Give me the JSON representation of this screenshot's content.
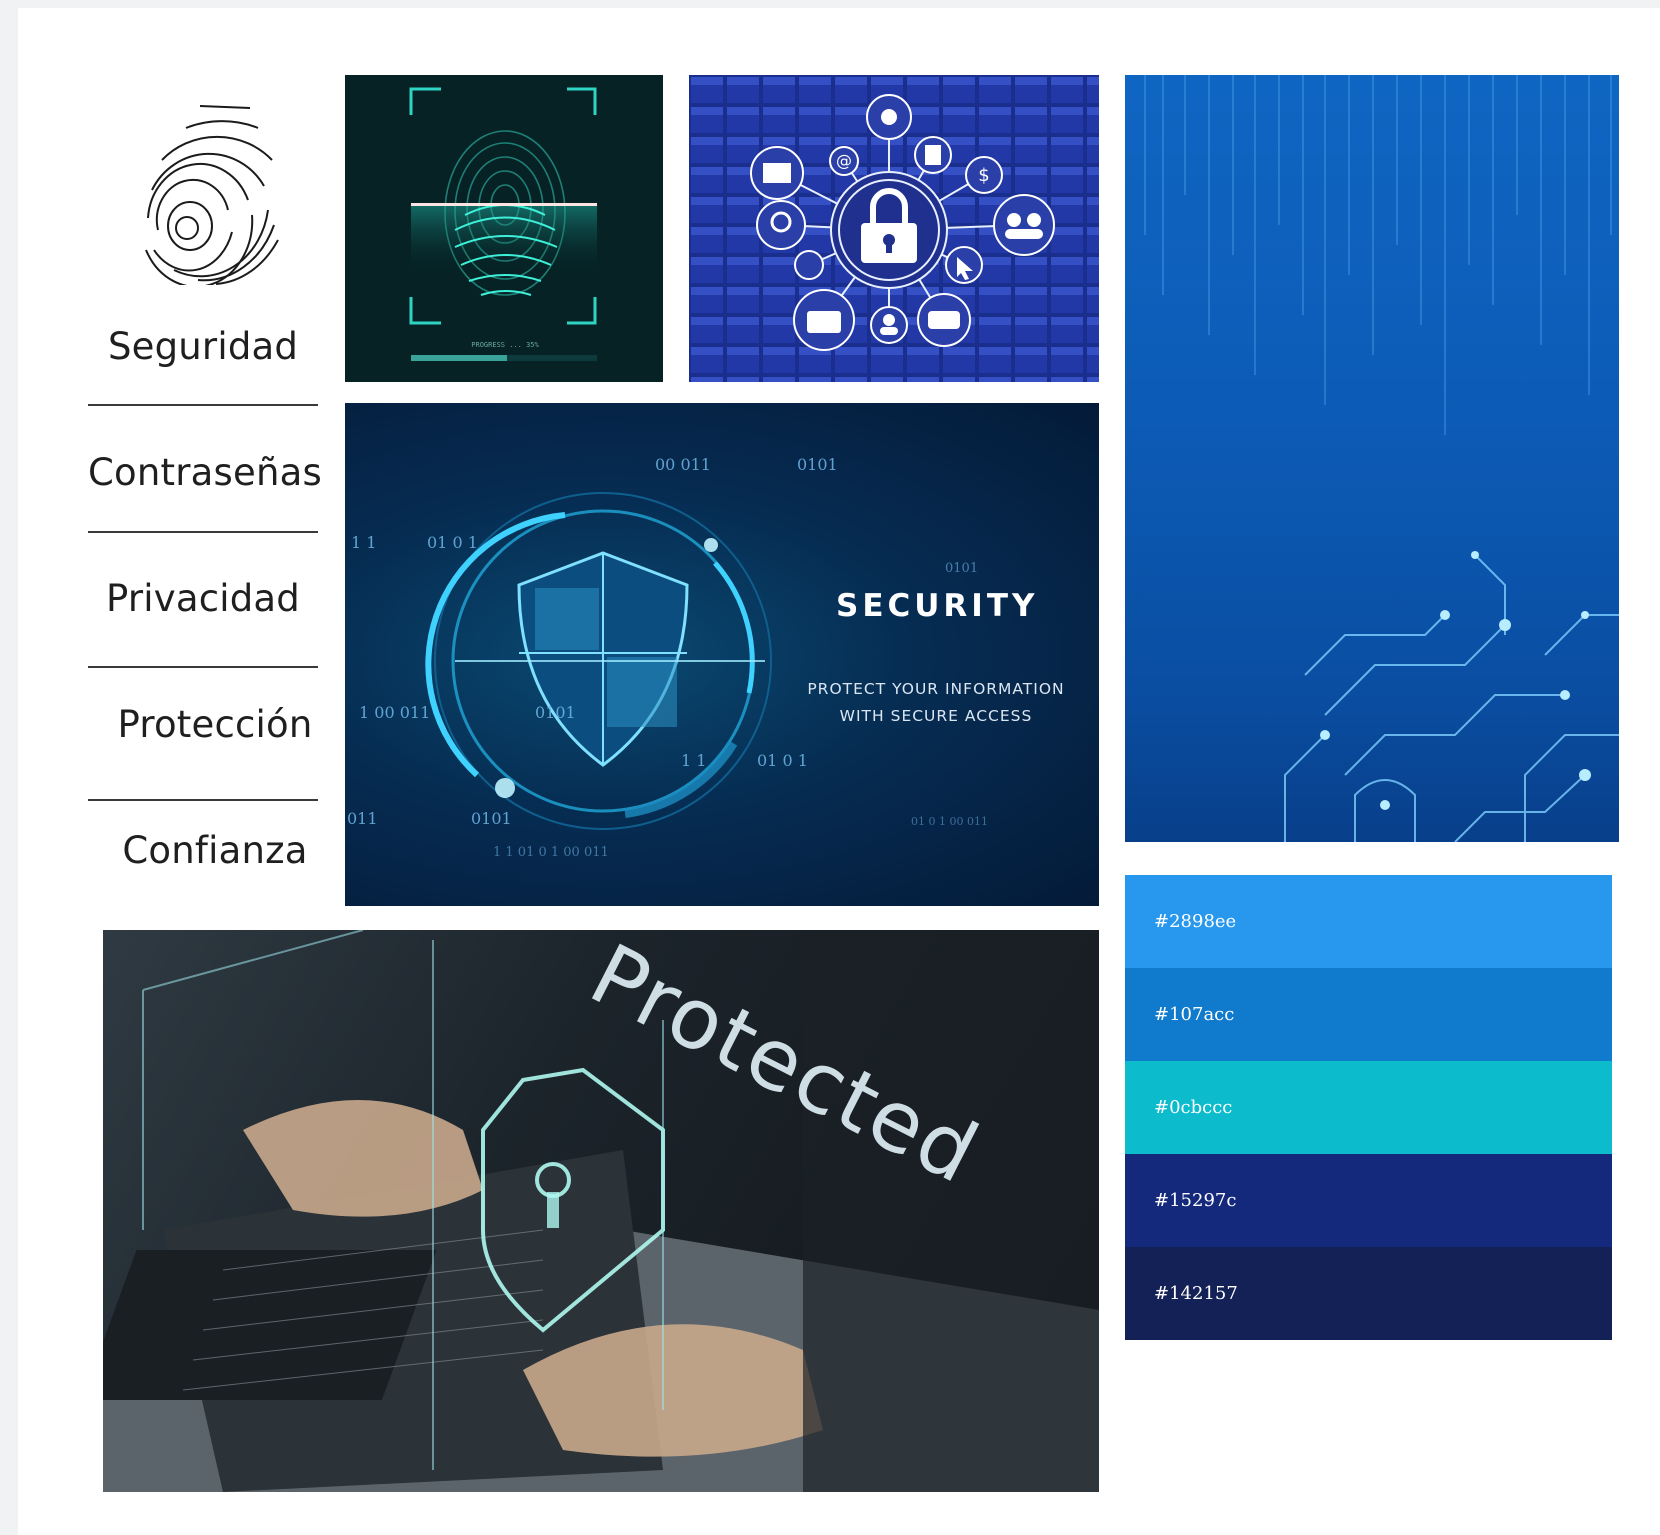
{
  "keywords": [
    "Seguridad",
    "Contraseñas",
    "Privacidad",
    "Protección",
    "Confianza"
  ],
  "security_graphic": {
    "title": "SECURITY",
    "subtitle_line1": "PROTECT YOUR INFORMATION",
    "subtitle_line2": "WITH SECURE ACCESS",
    "binary": [
      "00 011",
      "0101",
      "1 1",
      "01 0 1",
      "1 00 011",
      "0101",
      "1 1",
      "01 0 1",
      "011",
      "0101",
      "1 1 01 0 1 00 011",
      "01 0 1 00 011",
      "0101"
    ]
  },
  "fingerprint_scan": {
    "caption": "PROGRESS ... 35%"
  },
  "photo": {
    "overlay_text": "Protected"
  },
  "palette": [
    {
      "hex": "#2898ee",
      "label": "#2898ee"
    },
    {
      "hex": "#107acc",
      "label": "#107acc"
    },
    {
      "hex": "#0cbccc",
      "label": "#0cbccc"
    },
    {
      "hex": "#15297c",
      "label": "#15297c"
    },
    {
      "hex": "#142157",
      "label": "#142157"
    }
  ],
  "icons": {
    "fingerprint_logo": "fingerprint-icon",
    "network_hub": [
      "mail-icon",
      "at-icon",
      "gear-icon",
      "document-icon",
      "dollar-icon",
      "users-icon",
      "cursor-icon",
      "chat-icon",
      "user-icon",
      "camera-icon",
      "wifi-icon",
      "search-icon",
      "padlock-icon"
    ]
  }
}
